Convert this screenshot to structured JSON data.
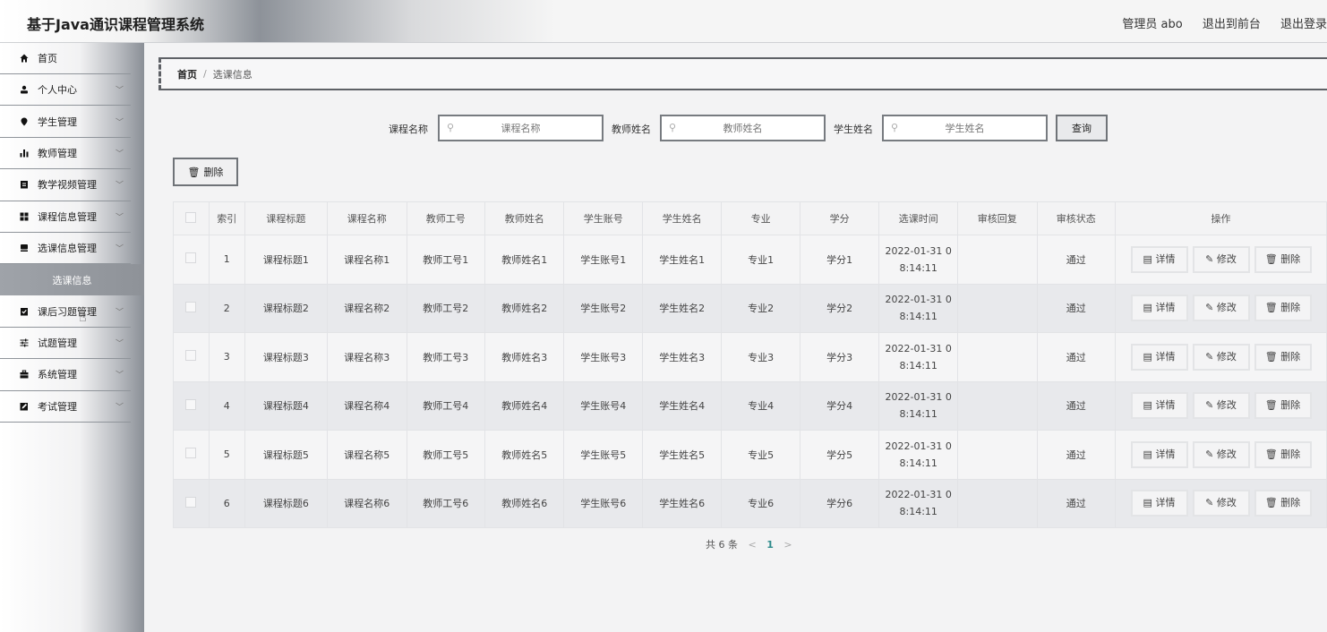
{
  "header": {
    "title": "基于Java通识课程管理系统",
    "admin": "管理员 abo",
    "front": "退出到前台",
    "logout": "退出登录"
  },
  "sidebar": {
    "items": [
      {
        "label": "首页",
        "icon": "home-icon"
      },
      {
        "label": "个人中心",
        "icon": "user-icon"
      },
      {
        "label": "学生管理",
        "icon": "location-icon"
      },
      {
        "label": "教师管理",
        "icon": "bar-chart-icon"
      },
      {
        "label": "教学视频管理",
        "icon": "clipboard-icon"
      },
      {
        "label": "课程信息管理",
        "icon": "grid-icon"
      },
      {
        "label": "选课信息管理",
        "icon": "stack-icon"
      },
      {
        "label": "课后习题管理",
        "icon": "clipboard-check-icon"
      },
      {
        "label": "试题管理",
        "icon": "sliders-icon"
      },
      {
        "label": "系统管理",
        "icon": "briefcase-icon"
      },
      {
        "label": "考试管理",
        "icon": "edit-box-icon"
      }
    ],
    "sub_active": "选课信息"
  },
  "breadcrumb": {
    "home": "首页",
    "sep": "/",
    "current": "选课信息"
  },
  "search": {
    "course_label": "课程名称",
    "course_placeholder": "课程名称",
    "teacher_label": "教师姓名",
    "teacher_placeholder": "教师姓名",
    "student_label": "学生姓名",
    "student_placeholder": "学生姓名",
    "query_button": "查询"
  },
  "toolbar": {
    "delete_label": "删除"
  },
  "table": {
    "headers": [
      "索引",
      "课程标题",
      "课程名称",
      "教师工号",
      "教师姓名",
      "学生账号",
      "学生姓名",
      "专业",
      "学分",
      "选课时间",
      "审核回复",
      "审核状态",
      "操作"
    ],
    "rows": [
      {
        "idx": "1",
        "title": "课程标题1",
        "name": "课程名称1",
        "tno": "教师工号1",
        "tname": "教师姓名1",
        "sacc": "学生账号1",
        "sname": "学生姓名1",
        "major": "专业1",
        "credit": "学分1",
        "time1": "2022-01-31 0",
        "time2": "8:14:11",
        "reply": "",
        "status": "通过"
      },
      {
        "idx": "2",
        "title": "课程标题2",
        "name": "课程名称2",
        "tno": "教师工号2",
        "tname": "教师姓名2",
        "sacc": "学生账号2",
        "sname": "学生姓名2",
        "major": "专业2",
        "credit": "学分2",
        "time1": "2022-01-31 0",
        "time2": "8:14:11",
        "reply": "",
        "status": "通过"
      },
      {
        "idx": "3",
        "title": "课程标题3",
        "name": "课程名称3",
        "tno": "教师工号3",
        "tname": "教师姓名3",
        "sacc": "学生账号3",
        "sname": "学生姓名3",
        "major": "专业3",
        "credit": "学分3",
        "time1": "2022-01-31 0",
        "time2": "8:14:11",
        "reply": "",
        "status": "通过"
      },
      {
        "idx": "4",
        "title": "课程标题4",
        "name": "课程名称4",
        "tno": "教师工号4",
        "tname": "教师姓名4",
        "sacc": "学生账号4",
        "sname": "学生姓名4",
        "major": "专业4",
        "credit": "学分4",
        "time1": "2022-01-31 0",
        "time2": "8:14:11",
        "reply": "",
        "status": "通过"
      },
      {
        "idx": "5",
        "title": "课程标题5",
        "name": "课程名称5",
        "tno": "教师工号5",
        "tname": "教师姓名5",
        "sacc": "学生账号5",
        "sname": "学生姓名5",
        "major": "专业5",
        "credit": "学分5",
        "time1": "2022-01-31 0",
        "time2": "8:14:11",
        "reply": "",
        "status": "通过"
      },
      {
        "idx": "6",
        "title": "课程标题6",
        "name": "课程名称6",
        "tno": "教师工号6",
        "tname": "教师姓名6",
        "sacc": "学生账号6",
        "sname": "学生姓名6",
        "major": "专业6",
        "credit": "学分6",
        "time1": "2022-01-31 0",
        "time2": "8:14:11",
        "reply": "",
        "status": "通过"
      }
    ],
    "actions": {
      "detail": "详情",
      "edit": "修改",
      "delete": "删除"
    }
  },
  "pagination": {
    "total": "共 6 条",
    "prev": "<",
    "page": "1",
    "next": ">"
  }
}
